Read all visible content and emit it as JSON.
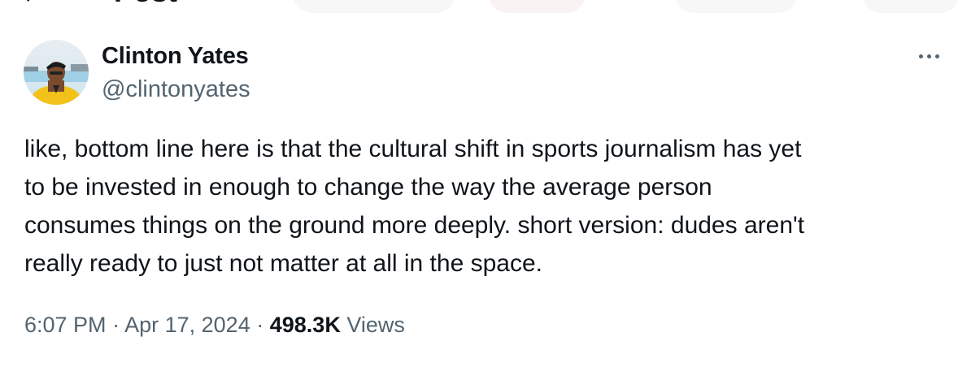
{
  "header": {
    "title": "Post"
  },
  "author": {
    "name": "Clinton Yates",
    "handle": "@clintonyates"
  },
  "tweet": {
    "lines": [
      "like, bottom line here is that the cultural shift in sports journalism has yet",
      "to be invested in enough to change the way the average person",
      "consumes things on the ground more deeply. short version: dudes aren't",
      "really ready to just not matter at all in the space."
    ]
  },
  "meta": {
    "time": "6:07 PM",
    "separator": "·",
    "date": "Apr 17, 2024",
    "views_count": "498.3K",
    "views_label": "Views"
  },
  "colors": {
    "text": "#0f1419",
    "secondary": "#536471",
    "background": "#ffffff"
  },
  "icons": {
    "back": "arrow-left-icon",
    "more": "more-horizontal-icon"
  }
}
